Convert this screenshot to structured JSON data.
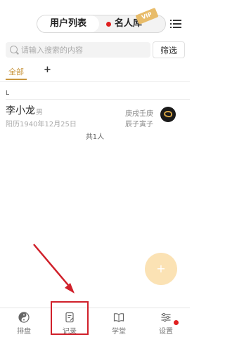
{
  "header": {
    "segments": [
      "用户列表",
      "名人库"
    ],
    "vip_badge": "VIP",
    "menu_icon": "list-menu-icon"
  },
  "search": {
    "placeholder": "请输入搜索的内容",
    "filter_label": "筛选"
  },
  "tabs": {
    "active": "全部",
    "add": "+"
  },
  "list": {
    "section_letter": "L",
    "items": [
      {
        "name": "李小龙",
        "gender": "男",
        "birth": "阳历1940年12月25日",
        "pillars_line1": "庚戌壬庚",
        "pillars_line2": "辰子寅子",
        "avatar_icon": "dragon-avatar-icon"
      }
    ],
    "count_text": "共1人"
  },
  "fab": {
    "label": "+"
  },
  "bottom_nav": [
    {
      "label": "排盘",
      "icon": "yin-yang-icon"
    },
    {
      "label": "记录",
      "icon": "notebook-icon"
    },
    {
      "label": "学堂",
      "icon": "book-icon"
    },
    {
      "label": "设置",
      "icon": "sliders-icon"
    }
  ],
  "colors": {
    "accent": "#c9963f",
    "annotation": "#d0202a",
    "badge_red": "#e02020",
    "fab": "#fbe2b4"
  }
}
